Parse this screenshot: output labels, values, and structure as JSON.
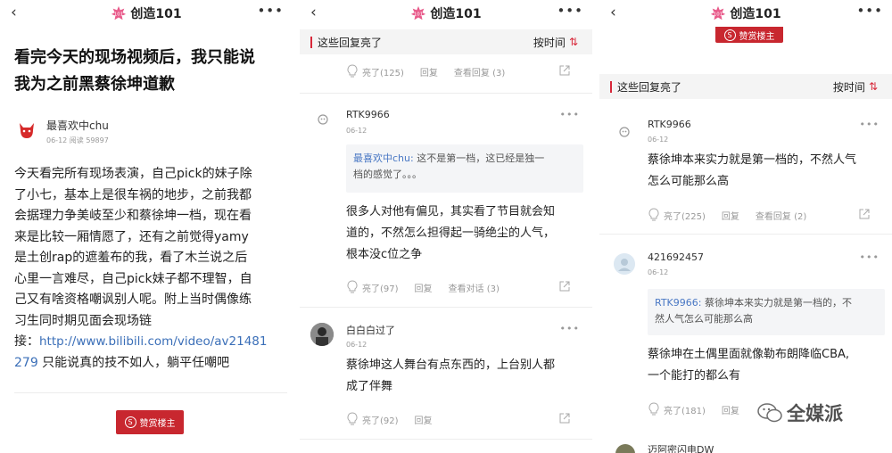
{
  "app": {
    "title": "创造101"
  },
  "panel1": {
    "headline": [
      "看完今天的现场视频后，我只能说",
      "我为之前黑蔡徐坤道歉"
    ],
    "author": "最喜欢中chu",
    "meta": "06-12 阅读 59897",
    "body": [
      "今天看完所有现场表演，自己pick的妹子除",
      "了小七，基本上是很车祸的地步，之前我都",
      "会据理力争美岐至少和蔡徐坤一档，现在看",
      "来是比较一厢情愿了，还有之前觉得yamy",
      "是土创rap的遮羞布的我，看了木兰说之后",
      "心里一言难尽，自己pick妹子都不理智，自",
      "己又有啥资格嘲讽别人呢。附上当时偶像练",
      "习生同时期见面会现场链"
    ],
    "link_prefix": "接：",
    "link_text_1": "http://www.bilibili.com/video/av21481",
    "link_text_2": "279",
    "body_end": " 只能说真的技不如人，躺平任嘲吧",
    "reward_label": "赞赏楼主"
  },
  "panel2": {
    "section_label": "这些回复亮了",
    "sort_label": "按时间",
    "top_actions": {
      "like": "亮了(125)",
      "reply": "回复",
      "view": "查看回复 (3)"
    },
    "comments": [
      {
        "user": "RTK9966",
        "date": "06-12",
        "quote_name": "最喜欢中chu:",
        "quote_text_1": " 这不是第一档，这已经是独一",
        "quote_text_2": "档的感觉了。。。",
        "text": [
          "很多人对他有偏见，其实看了节目就会知",
          "道的，不然怎么担得起一骑绝尘的人气，",
          "根本没c位之争"
        ],
        "like": "亮了(97)",
        "reply": "回复",
        "view": "查看对话 (3)"
      },
      {
        "user": "白白白过了",
        "date": "06-12",
        "text": [
          "蔡徐坤这人舞台有点东西的，上台别人都",
          "成了伴舞"
        ],
        "like": "亮了(92)",
        "reply": "回复"
      }
    ]
  },
  "panel3": {
    "reward_label": "赞赏楼主",
    "section_label": "这些回复亮了",
    "sort_label": "按时间",
    "comments": [
      {
        "user": "RTK9966",
        "date": "06-12",
        "text": [
          "蔡徐坤本来实力就是第一档的，不然人气",
          "怎么可能那么高"
        ],
        "like": "亮了(225)",
        "reply": "回复",
        "view": "查看回复 (2)"
      },
      {
        "user": "421692457",
        "date": "06-12",
        "quote_name": "RTK9966:",
        "quote_text_1": " 蔡徐坤本来实力就是第一档的，不",
        "quote_text_2": "然人气怎么可能那么高",
        "text": [
          "蔡徐坤在土偶里面就像勒布朗降临CBA,",
          "一个能打的都么有"
        ],
        "like": "亮了(181)",
        "reply": "回复"
      },
      {
        "user": "迈阿密闪电DW"
      }
    ],
    "watermark": "全媒派"
  }
}
